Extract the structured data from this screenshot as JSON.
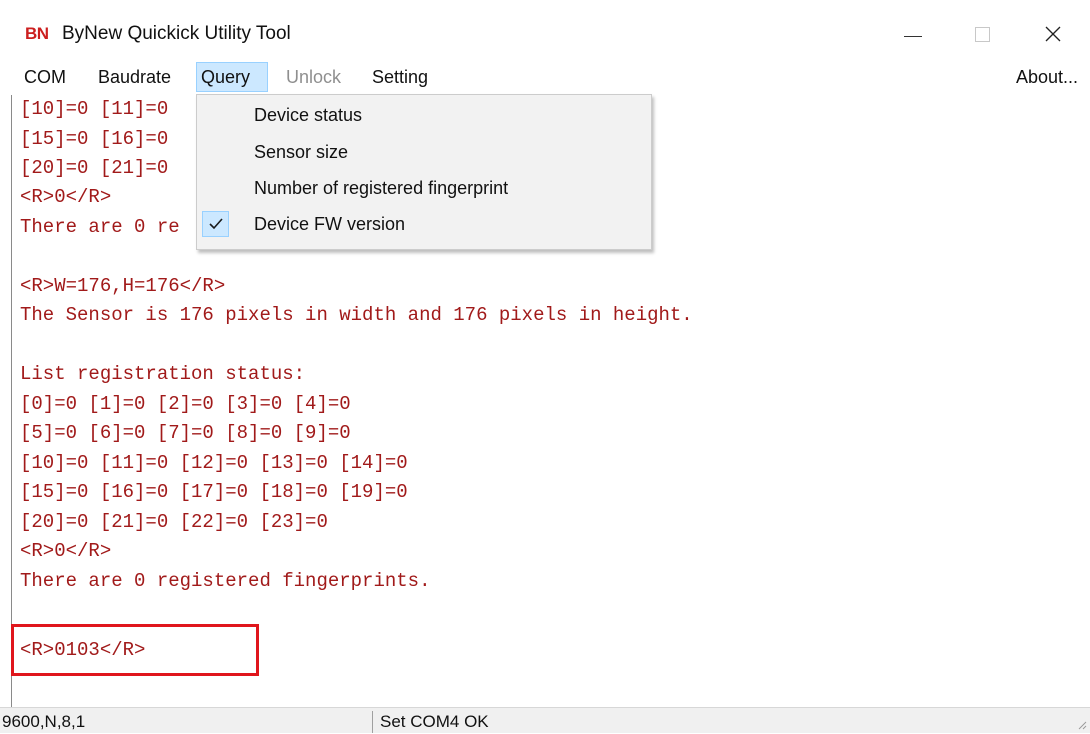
{
  "window": {
    "logo": "BN",
    "title": "ByNew Quickick Utility Tool",
    "controls": {
      "minimize": "minimize-icon",
      "maximize": "maximize-icon",
      "close": "close-icon"
    }
  },
  "menubar": {
    "items": [
      {
        "label": "COM",
        "state": "normal"
      },
      {
        "label": "Baudrate",
        "state": "normal"
      },
      {
        "label": "Query",
        "state": "active"
      },
      {
        "label": "Unlock",
        "state": "disabled"
      },
      {
        "label": "Setting",
        "state": "normal"
      }
    ],
    "about": "About..."
  },
  "query_menu": {
    "items": [
      {
        "label": "Device status",
        "checked": false
      },
      {
        "label": "Sensor size",
        "checked": false
      },
      {
        "label": "Number of registered fingerprint",
        "checked": false
      },
      {
        "label": "Device FW version",
        "checked": true
      }
    ]
  },
  "console": {
    "lines": [
      "[10]=0 [11]=0",
      "[15]=0 [16]=0",
      "[20]=0 [21]=0",
      "<R>0</R>",
      "There are 0 re",
      "",
      "<R>W=176,H=176</R>",
      "The Sensor is 176 pixels in width and 176 pixels in height.",
      "",
      "List registration status:",
      "[0]=0 [1]=0 [2]=0 [3]=0 [4]=0",
      "[5]=0 [6]=0 [7]=0 [8]=0 [9]=0",
      "[10]=0 [11]=0 [12]=0 [13]=0 [14]=0",
      "[15]=0 [16]=0 [17]=0 [18]=0 [19]=0",
      "[20]=0 [21]=0 [22]=0 [23]=0",
      "<R>0</R>",
      "There are 0 registered fingerprints.",
      "",
      "<R>0103</R>"
    ],
    "text_color": "#a11a1a",
    "highlight_color": "#e0161c"
  },
  "statusbar": {
    "port_settings": "9600,N,8,1",
    "message": "Set COM4 OK"
  }
}
